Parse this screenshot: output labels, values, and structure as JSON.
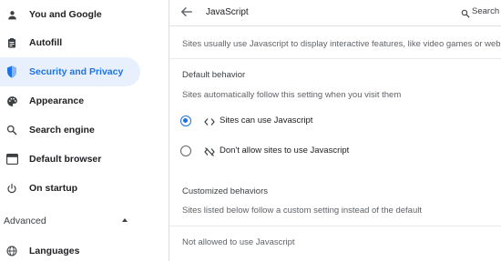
{
  "sidebar": {
    "items": [
      {
        "label": "You and Google",
        "icon": "google-icon"
      },
      {
        "label": "Autofill",
        "icon": "clipboard-icon"
      },
      {
        "label": "Security and Privacy",
        "icon": "shield-icon",
        "active": true
      },
      {
        "label": "Appearance",
        "icon": "palette-icon"
      },
      {
        "label": "Search engine",
        "icon": "search-icon"
      },
      {
        "label": "Default browser",
        "icon": "browser-icon"
      },
      {
        "label": "On startup",
        "icon": "power-icon"
      }
    ],
    "advanced_label": "Advanced",
    "advanced_items": [
      {
        "label": "Languages",
        "icon": "globe-icon"
      }
    ]
  },
  "header": {
    "title": "JavaScript",
    "search_label": "Search"
  },
  "main": {
    "description": "Sites usually use Javascript to display interactive features, like video games or web forms",
    "default_behavior": {
      "heading": "Default behavior",
      "subtext": "Sites automatically follow this setting when you visit them",
      "options": [
        {
          "label": "Sites can use Javascript",
          "icon": "code-icon",
          "checked": true
        },
        {
          "label": "Don't allow sites to use Javascript",
          "icon": "code-off-icon",
          "checked": false
        }
      ]
    },
    "customized": {
      "heading": "Customized behaviors",
      "subtext": "Sites listed below follow a custom setting instead of the default",
      "not_allowed_label": "Not allowed to use Javascript"
    }
  },
  "colors": {
    "accent": "#1a73e8",
    "active_bg": "#e8f0fe",
    "text": "#202124",
    "secondary_text": "#5f6368"
  }
}
